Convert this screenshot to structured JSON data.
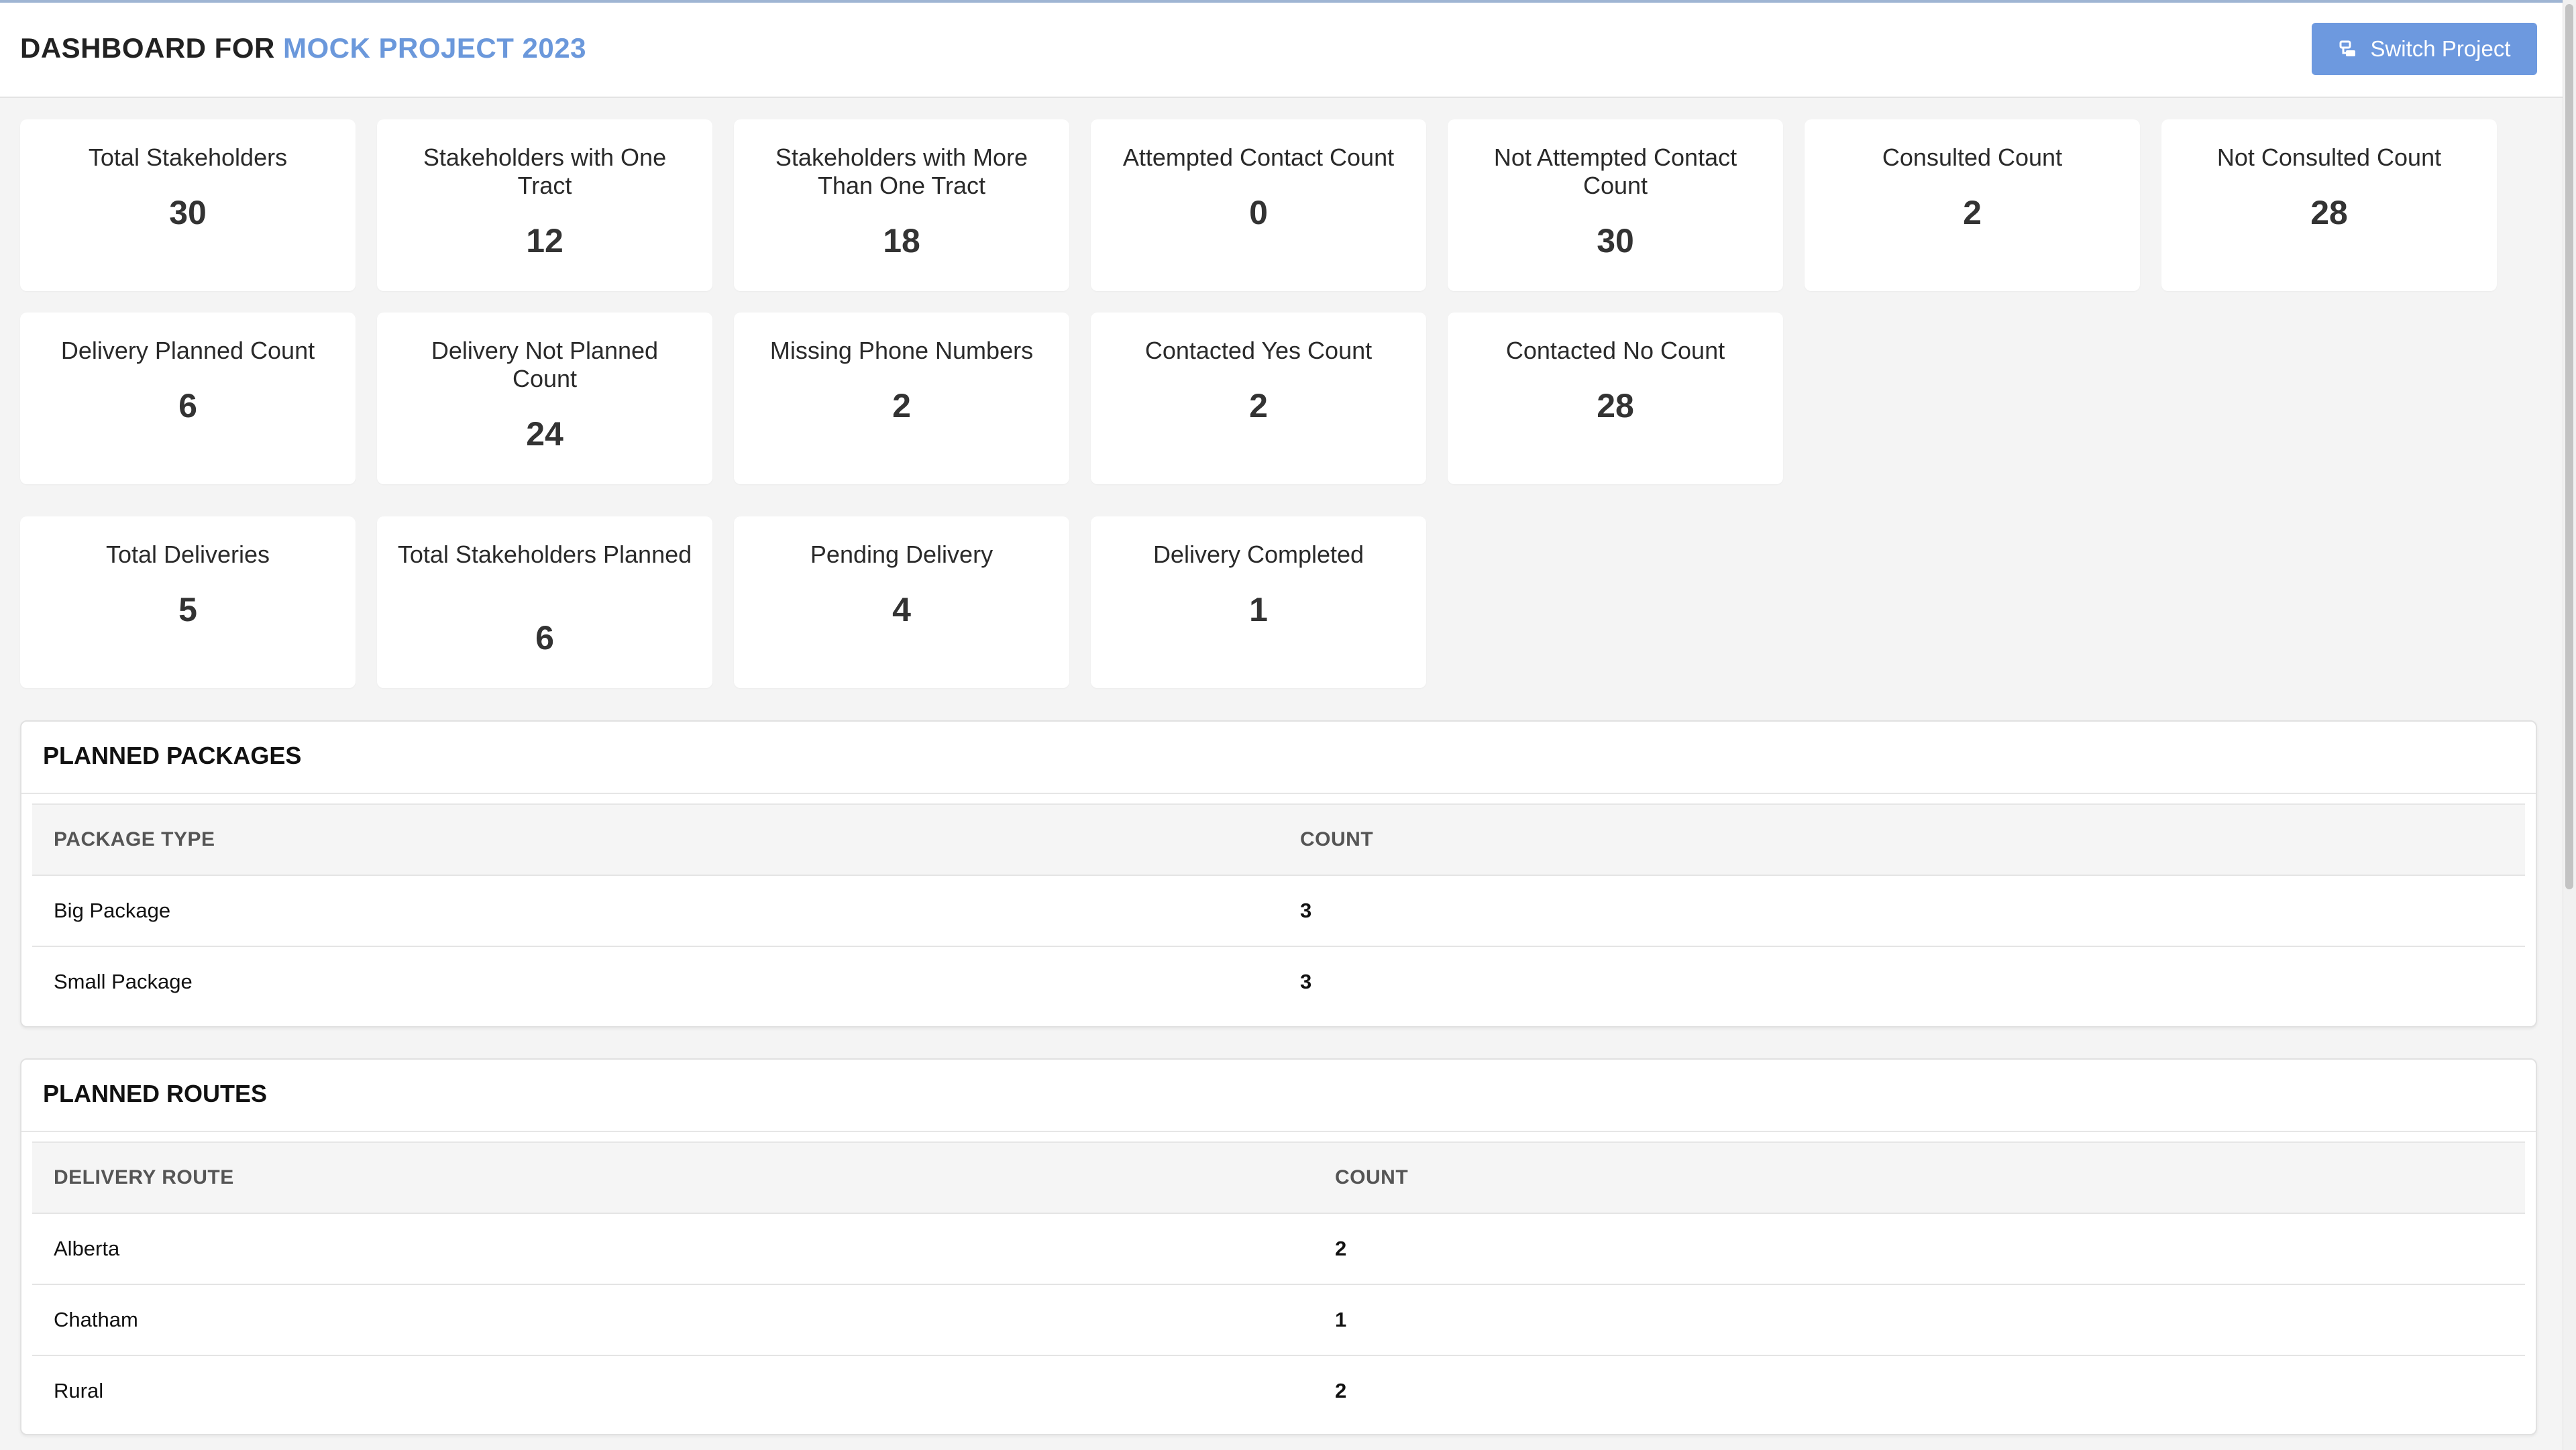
{
  "header": {
    "title_prefix": "DASHBOARD FOR",
    "project_name": "MOCK PROJECT 2023",
    "switch_button_label": "Switch Project",
    "switch_icon": "switch-icon"
  },
  "stats": {
    "total_stakeholders": {
      "label": "Total Stakeholders",
      "value": "30"
    },
    "stakeholders_one_tract": {
      "label": "Stakeholders with One Tract",
      "value": "12"
    },
    "stakeholders_more_tract": {
      "label": "Stakeholders with More Than One Tract",
      "value": "18"
    },
    "attempted_contact": {
      "label": "Attempted Contact Count",
      "value": "0"
    },
    "not_attempted_contact": {
      "label": "Not Attempted Contact Count",
      "value": "30"
    },
    "consulted": {
      "label": "Consulted Count",
      "value": "2"
    },
    "not_consulted": {
      "label": "Not Consulted Count",
      "value": "28"
    },
    "delivery_planned": {
      "label": "Delivery Planned Count",
      "value": "6"
    },
    "delivery_not_planned": {
      "label": "Delivery Not Planned Count",
      "value": "24"
    },
    "missing_phone": {
      "label": "Missing Phone Numbers",
      "value": "2"
    },
    "contacted_yes": {
      "label": "Contacted Yes Count",
      "value": "2"
    },
    "contacted_no": {
      "label": "Contacted No Count",
      "value": "28"
    },
    "total_deliveries": {
      "label": "Total Deliveries",
      "value": "5"
    },
    "total_stakeholders_planned": {
      "label": "Total Stakeholders Planned",
      "value": "6"
    },
    "pending_delivery": {
      "label": "Pending Delivery",
      "value": "4"
    },
    "delivery_completed": {
      "label": "Delivery Completed",
      "value": "1"
    }
  },
  "planned_packages": {
    "title": "PLANNED PACKAGES",
    "columns": [
      "PACKAGE TYPE",
      "COUNT"
    ],
    "rows": [
      {
        "name": "Big Package",
        "count": "3"
      },
      {
        "name": "Small Package",
        "count": "3"
      }
    ]
  },
  "planned_routes": {
    "title": "PLANNED ROUTES",
    "columns": [
      "DELIVERY ROUTE",
      "COUNT"
    ],
    "rows": [
      {
        "name": "Alberta",
        "count": "2"
      },
      {
        "name": "Chatham",
        "count": "1"
      },
      {
        "name": "Rural",
        "count": "2"
      }
    ]
  },
  "colors": {
    "accent": "#6d99df",
    "project_name": "#6b98db",
    "background": "#f4f4f4"
  }
}
